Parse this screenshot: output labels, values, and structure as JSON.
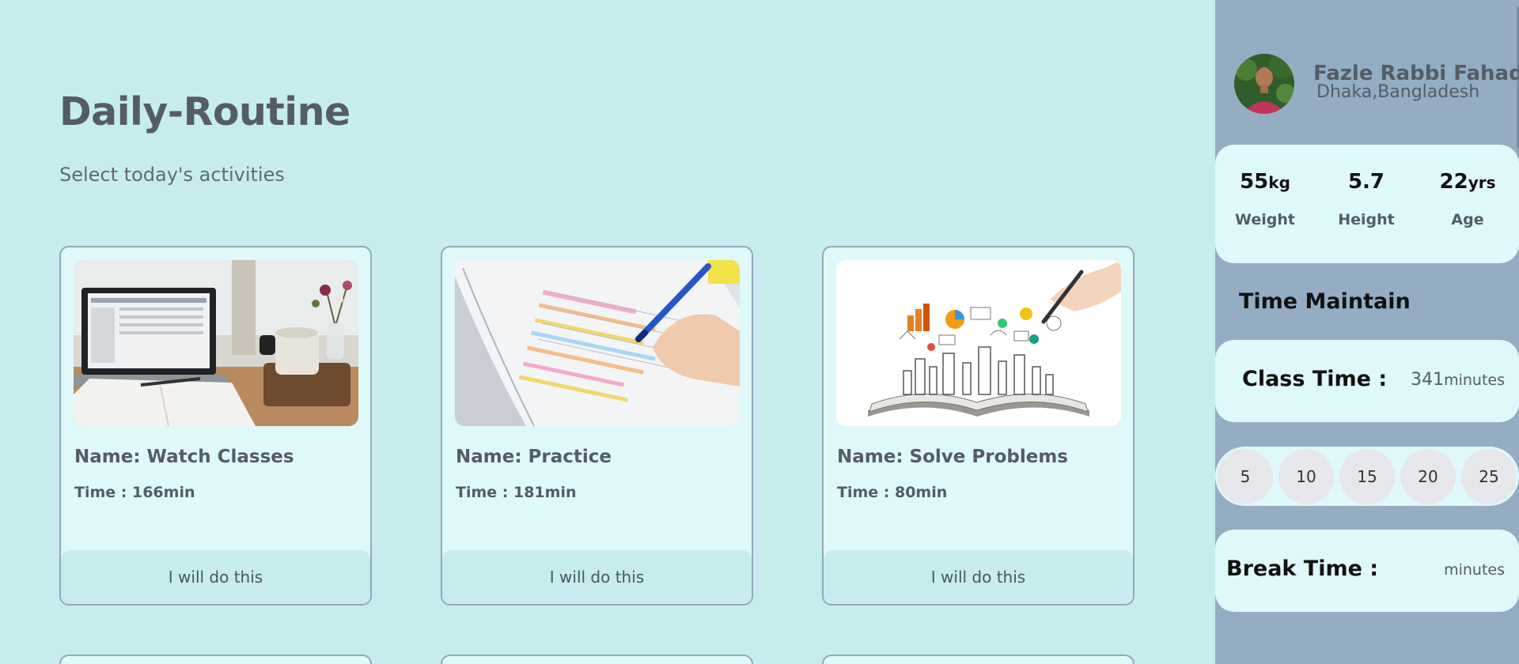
{
  "header": {
    "title": "Daily-Routine",
    "subtitle": "Select today's activities"
  },
  "cards": [
    {
      "name": "Name: Watch Classes",
      "time": "Time : 166min",
      "button": "I will do this",
      "image_icon": "laptop-desk-photo"
    },
    {
      "name": "Name: Practice",
      "time": "Time : 181min",
      "button": "I will do this",
      "image_icon": "writing-notes-photo"
    },
    {
      "name": "Name: Solve Problems",
      "time": "Time : 80min",
      "button": "I will do this",
      "image_icon": "open-book-sketch-photo"
    }
  ],
  "profile": {
    "name": "Fazle Rabbi Fahad",
    "location": "Dhaka,Bangladesh"
  },
  "stats": [
    {
      "value": "55",
      "unit": "kg",
      "label": "Weight"
    },
    {
      "value": "5.7",
      "unit": "",
      "label": "Height"
    },
    {
      "value": "22",
      "unit": "yrs",
      "label": "Age"
    }
  ],
  "time_maintain": {
    "title": "Time Maintain",
    "class_label": "Class Time :",
    "class_value": "341",
    "class_unit": "minutes",
    "break_options": [
      "5",
      "10",
      "15",
      "20",
      "25"
    ],
    "break_label": "Break Time :",
    "break_value": "",
    "break_unit": "minutes"
  },
  "colors": {
    "background": "#c7ecee",
    "sidebar": "#94adc2",
    "card": "#dff8fa",
    "card_border": "#93a7bb"
  }
}
